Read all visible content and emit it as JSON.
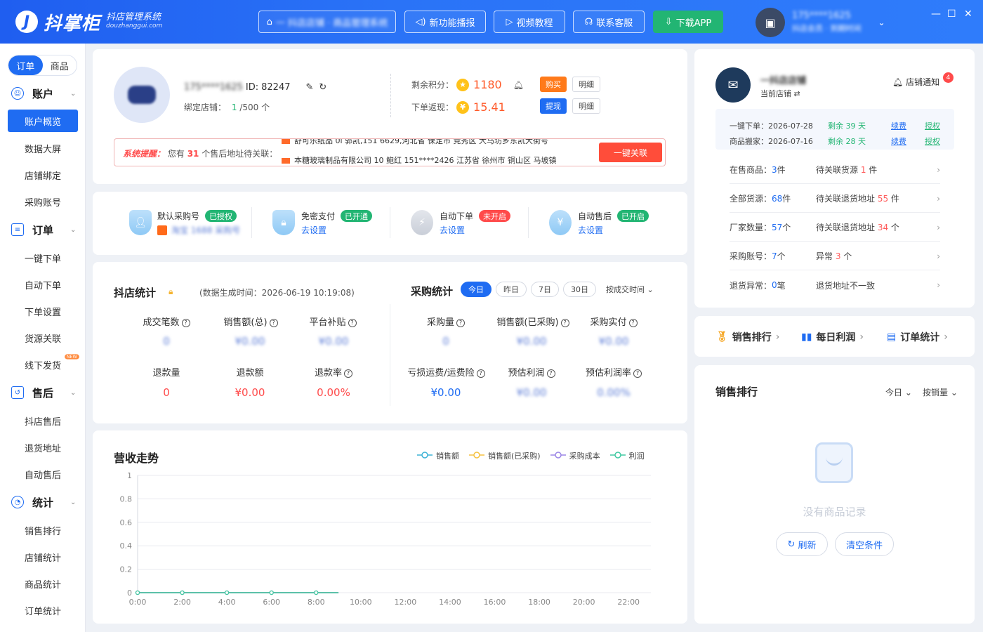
{
  "header": {
    "brand": "抖掌柜",
    "sub_title": "抖店管理系统",
    "sub_url": "douzhanggui.com",
    "store_selector": "一  抖店店铺 · 商品管理系统",
    "btn_news": "新功能播报",
    "btn_video": "视频教程",
    "btn_service": "联系客服",
    "btn_download": "下载APP",
    "user_name": "175****1625",
    "user_sub": "抖店会员 · 到期时间"
  },
  "sidebar": {
    "seg_order": "订单",
    "seg_goods": "商品",
    "groups": [
      "账户",
      "订单",
      "售后",
      "统计"
    ],
    "account_items": [
      "账户概览",
      "数据大屏",
      "店铺绑定",
      "采购账号"
    ],
    "order_items": [
      "一键下单",
      "自动下单",
      "下单设置",
      "货源关联",
      "线下发货"
    ],
    "new_badge": "NEW",
    "aftersale_items": [
      "抖店售后",
      "退货地址",
      "自动售后"
    ],
    "stat_items": [
      "销售排行",
      "店铺统计",
      "商品统计",
      "订单统计"
    ]
  },
  "profile": {
    "phone": "175****1625",
    "id_label": "ID:",
    "id_value": "82247",
    "bind_label": "绑定店铺：",
    "bind_count": "1",
    "bind_total": "/500 个",
    "points_label": "剩余积分：",
    "points_value": "1180",
    "rebate_label": "下单返现：",
    "rebate_value": "15.41",
    "btn_buy": "购买",
    "btn_detail": "明细",
    "btn_withdraw": "提现",
    "btn_detail2": "明细"
  },
  "notice": {
    "title": "系统提醒：",
    "text_before": "您有",
    "count": "31",
    "text_after": "个售后地址待关联：",
    "line1": "舒可乐纸品 0l 郭凯,151          6629,河北省 保定市 竞秀区 大马坊乡东凯大街号",
    "line2": "本糖玻璃制品有限公司 10 鲍红 151****2426 江苏省 徐州市 铜山区 马坡镇",
    "button": "一键关联"
  },
  "features": [
    {
      "title": "默认采购号",
      "badge": "已授权",
      "sub": "淘宝 1688 采购号",
      "badge_color": "#22b573"
    },
    {
      "title": "免密支付",
      "badge": "已开通",
      "sub": "去设置",
      "badge_color": "#22b573"
    },
    {
      "title": "自动下单",
      "badge": "未开启",
      "sub": "去设置",
      "badge_color": "#ff4a4a"
    },
    {
      "title": "自动售后",
      "badge": "已开启",
      "sub": "去设置",
      "badge_color": "#22b573"
    }
  ],
  "shop_stats": {
    "title": "抖店统计",
    "gen_time": "(数据生成时间：2026-06-19 10:19:08)",
    "labels": [
      "成交笔数",
      "销售额(总)",
      "平台补贴",
      "退款量",
      "退款额",
      "退款率"
    ],
    "values": [
      "0",
      "¥0.00",
      "¥0.00",
      "0",
      "¥0.00",
      "0.00%"
    ]
  },
  "purchase_stats": {
    "title": "采购统计",
    "tabs": [
      "今日",
      "昨日",
      "7日",
      "30日"
    ],
    "sort": "按成交时间",
    "labels": [
      "采购量",
      "销售额(已采购)",
      "采购实付",
      "亏损运费/运费险",
      "预估利润",
      "预估利润率"
    ],
    "values": [
      "0",
      "¥0.00",
      "¥0.00",
      "¥0.00",
      "¥0.00",
      "0.00%"
    ]
  },
  "chart_data": {
    "type": "line",
    "title": "营收走势",
    "x": [
      "0:00",
      "2:00",
      "4:00",
      "6:00",
      "8:00",
      "10:00",
      "12:00",
      "14:00",
      "16:00",
      "18:00",
      "20:00",
      "22:00"
    ],
    "y_ticks": [
      "1",
      "0.8",
      "0.6",
      "0.4",
      "0.2",
      "0"
    ],
    "ylim": [
      0,
      1
    ],
    "series": [
      {
        "name": "销售额",
        "color": "#3fb3d6",
        "values": [
          0,
          0,
          0,
          0,
          0
        ]
      },
      {
        "name": "销售额(已采购)",
        "color": "#f5c242",
        "values": [
          0,
          0,
          0,
          0,
          0
        ]
      },
      {
        "name": "采购成本",
        "color": "#9b86e6",
        "values": [
          0,
          0,
          0,
          0,
          0
        ]
      },
      {
        "name": "利润",
        "color": "#40c9a2",
        "values": [
          0,
          0,
          0,
          0,
          0
        ]
      }
    ],
    "grid": true,
    "legend": "top-right"
  },
  "shop": {
    "name": "一抖店店铺",
    "current": "当前店铺",
    "notify": "店铺通知",
    "notify_count": "4",
    "renew_rows": [
      {
        "label": "一键下单：",
        "date": "2026-07-28",
        "remain": "剩余 39 天",
        "renew": "续费",
        "auth": "授权"
      },
      {
        "label": "商品搬家：",
        "date": "2026-07-16",
        "remain": "剩余 28 天",
        "renew": "续费",
        "auth": "授权"
      }
    ],
    "rows": [
      {
        "l1": "在售商品：",
        "v1": "3",
        "u1": " 件",
        "l2": "待关联货源 ",
        "v2": "1",
        "u2": " 件"
      },
      {
        "l1": "全部货源：",
        "v1": "68",
        "u1": " 件",
        "l2": "待关联退货地址 ",
        "v2": "55",
        "u2": " 件"
      },
      {
        "l1": "厂家数量：",
        "v1": "57",
        "u1": " 个",
        "l2": "待关联退货地址 ",
        "v2": "34",
        "u2": " 个"
      },
      {
        "l1": "采购账号：",
        "v1": "7",
        "u1": " 个",
        "l2": "异常 ",
        "v2": "3",
        "u2": " 个"
      },
      {
        "l1": "退货异常：",
        "v1": "0",
        "u1": " 笔",
        "l2": "退货地址不一致",
        "v2": "",
        "u2": ""
      }
    ]
  },
  "quick_links": [
    "销售排行",
    "每日利润",
    "订单统计"
  ],
  "ranking": {
    "title": "销售排行",
    "filter_day": "今日",
    "filter_sort": "按销量",
    "empty": "没有商品记录",
    "btn_refresh": "刷新",
    "btn_clear": "清空条件"
  }
}
